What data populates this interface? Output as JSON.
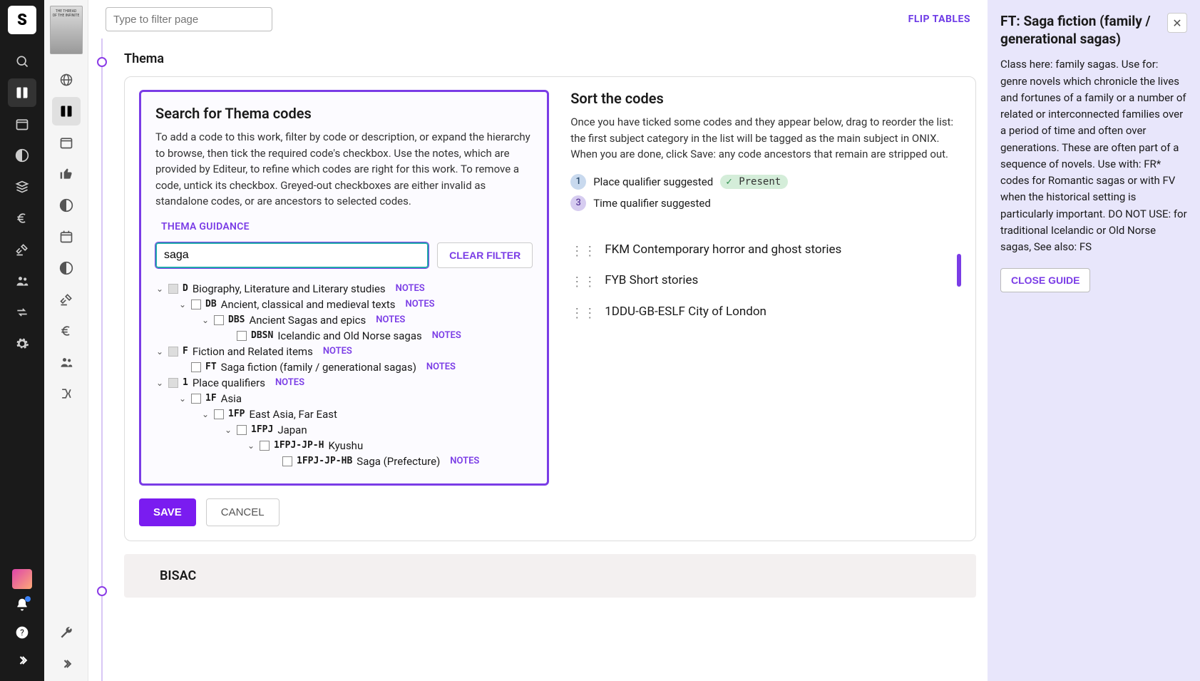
{
  "topbar": {
    "filter_placeholder": "Type to filter page",
    "flip_label": "FLIP TABLES"
  },
  "section": {
    "thema_title": "Thema",
    "bisac_title": "BISAC"
  },
  "search": {
    "heading": "Search for Thema codes",
    "desc": "To add a code to this work, filter by code or description, or expand the hierarchy to browse, then tick the required code's checkbox. Use the notes, which are provided by Editeur, to refine which codes are right for this work. To remove a code, untick its checkbox. Greyed-out checkboxes are either invalid as standalone codes, or are ancestors to selected codes.",
    "guidance_label": "THEMA GUIDANCE",
    "filter_value": "saga",
    "clear_label": "CLEAR FILTER",
    "notes_label": "NOTES"
  },
  "tree": [
    {
      "indent": 1,
      "chev": true,
      "grey": true,
      "code": "D",
      "label": "Biography, Literature and Literary studies",
      "notes": true
    },
    {
      "indent": 2,
      "chev": true,
      "grey": false,
      "code": "DB",
      "label": "Ancient, classical and medieval texts",
      "notes": true
    },
    {
      "indent": 3,
      "chev": true,
      "grey": false,
      "code": "DBS",
      "label": "Ancient Sagas and epics",
      "notes": true
    },
    {
      "indent": 4,
      "chev": false,
      "grey": false,
      "code": "DBSN",
      "label": "Icelandic and Old Norse sagas",
      "notes": true
    },
    {
      "indent": 1,
      "chev": true,
      "grey": true,
      "code": "F",
      "label": "Fiction and Related items",
      "notes": true
    },
    {
      "indent": 2,
      "chev": false,
      "grey": false,
      "code": "FT",
      "label": "Saga fiction (family / generational sagas)",
      "notes": true
    },
    {
      "indent": 1,
      "chev": true,
      "grey": true,
      "code": "1",
      "label": "Place qualifiers",
      "notes": true
    },
    {
      "indent": 2,
      "chev": true,
      "grey": false,
      "code": "1F",
      "label": "Asia",
      "notes": false
    },
    {
      "indent": 3,
      "chev": true,
      "grey": false,
      "code": "1FP",
      "label": "East Asia, Far East",
      "notes": false
    },
    {
      "indent": 4,
      "chev": true,
      "grey": false,
      "code": "1FPJ",
      "label": "Japan",
      "notes": false
    },
    {
      "indent": 5,
      "chev": true,
      "grey": false,
      "code": "1FPJ-JP-H",
      "label": "Kyushu",
      "notes": false
    },
    {
      "indent": 6,
      "chev": false,
      "grey": false,
      "code": "1FPJ-JP-HB",
      "label": "Saga (Prefecture)",
      "notes": true
    }
  ],
  "sort": {
    "heading": "Sort the codes",
    "desc": "Once you have ticked some codes and they appear below, drag to reorder the list: the first subject category in the list will be tagged as the main subject in ONIX. When you are done, click Save: any code ancestors that remain are stripped out.",
    "q1_badge": "1",
    "q1_text": "Place qualifier suggested",
    "q1_present": "Present",
    "q3_badge": "3",
    "q3_text": "Time qualifier suggested"
  },
  "assigned": [
    {
      "code": "FKM",
      "label": "Contemporary horror and ghost stories"
    },
    {
      "code": "FYB",
      "label": "Short stories"
    },
    {
      "code": "1DDU-GB-ESLF",
      "label": "City of London"
    }
  ],
  "actions": {
    "save": "SAVE",
    "cancel": "CANCEL"
  },
  "guide": {
    "title": "FT: Saga fiction (family / generational sagas)",
    "body": "Class here: family sagas. Use for: genre novels which chronicle the lives and fortunes of a family or a number of related or interconnected families over a period of time and often over generations. These are often part of a sequence of novels. Use with: FR* codes for Romantic sagas or with FV when the historical setting is particularly important. DO NOT USE: for traditional Icelandic or Old Norse sagas, See also: FS",
    "close_label": "CLOSE GUIDE"
  }
}
